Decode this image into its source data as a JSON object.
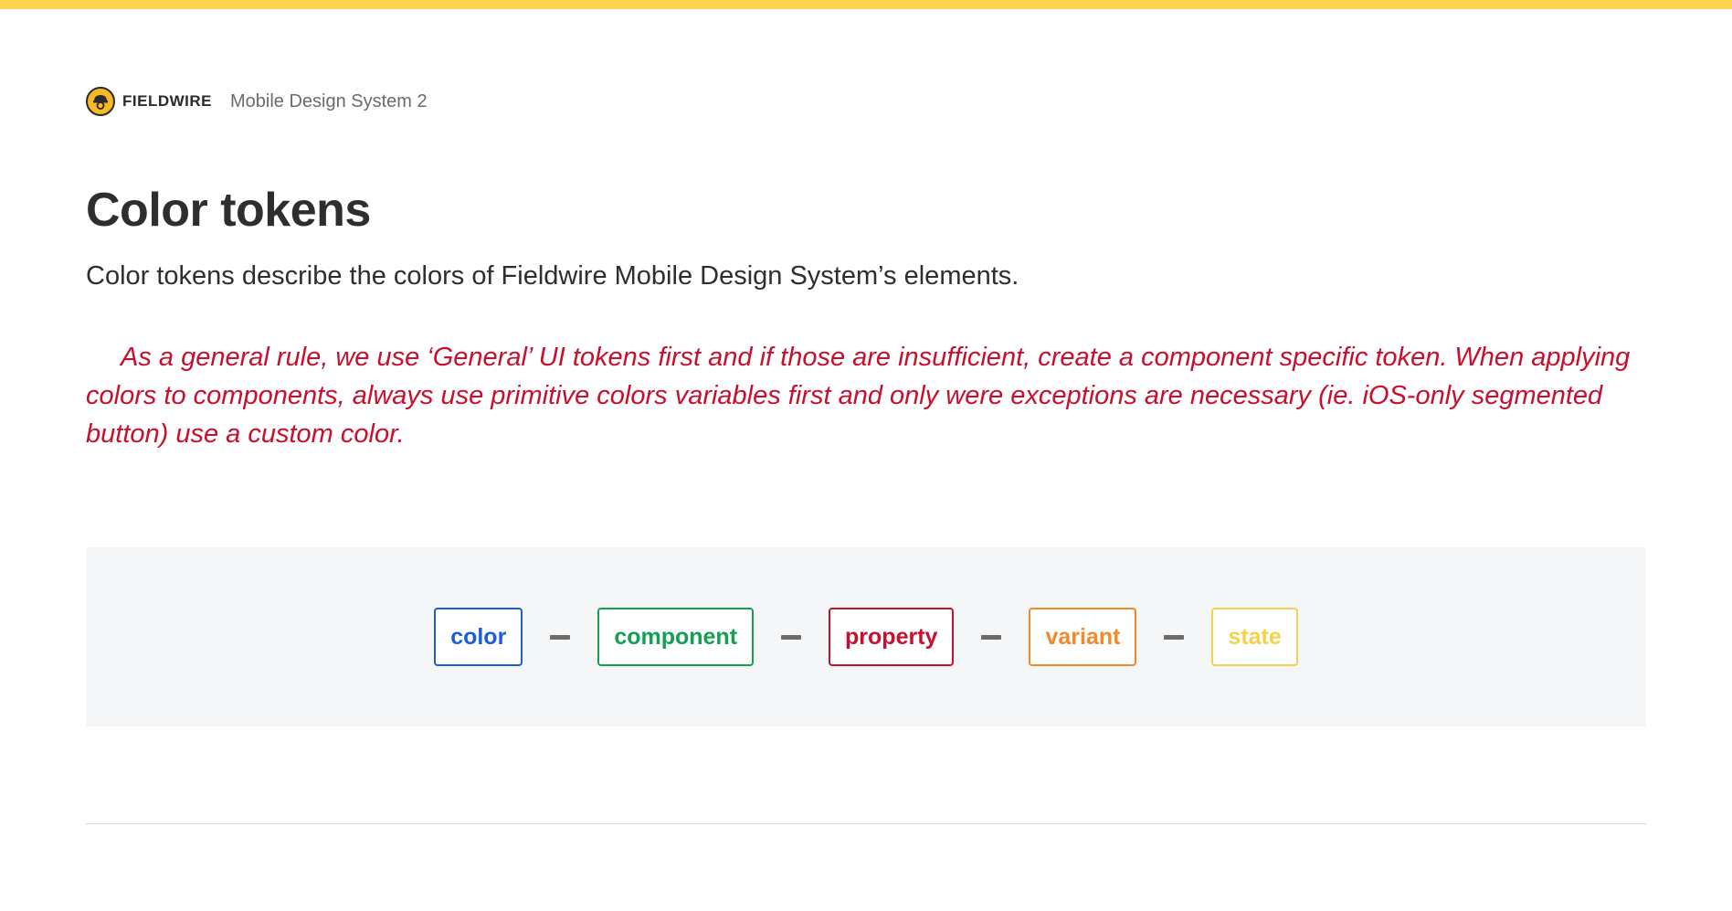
{
  "header": {
    "brand": "FIELDWIRE",
    "subtitle": "Mobile Design System 2"
  },
  "page": {
    "title": "Color tokens",
    "description": "Color tokens describe the colors of Fieldwire Mobile Design System’s elements.",
    "rule_note": "As a general rule, we use ‘General’ UI tokens first and if those are insufficient, create a component specific token. When applying colors to components, always use primitive colors variables first and only were exceptions are necessary (ie. iOS-only segmented button) use a custom color."
  },
  "colors": {
    "accent_bar": "#fed44e",
    "rule_note": "#c8102e",
    "token_color": "#1b5fd6",
    "token_component": "#15a051",
    "token_property": "#c8102e",
    "token_variant": "#f08a2b",
    "token_state": "#f2d34b"
  },
  "tokens": [
    {
      "label": "color",
      "color": "#1b5fd6"
    },
    {
      "label": "component",
      "color": "#15a051"
    },
    {
      "label": "property",
      "color": "#c8102e"
    },
    {
      "label": "variant",
      "color": "#f08a2b"
    },
    {
      "label": "state",
      "color": "#f2d34b"
    }
  ],
  "icons": {
    "logo": "fieldwire-worker-logo-icon",
    "separator": "dash-separator-icon"
  }
}
